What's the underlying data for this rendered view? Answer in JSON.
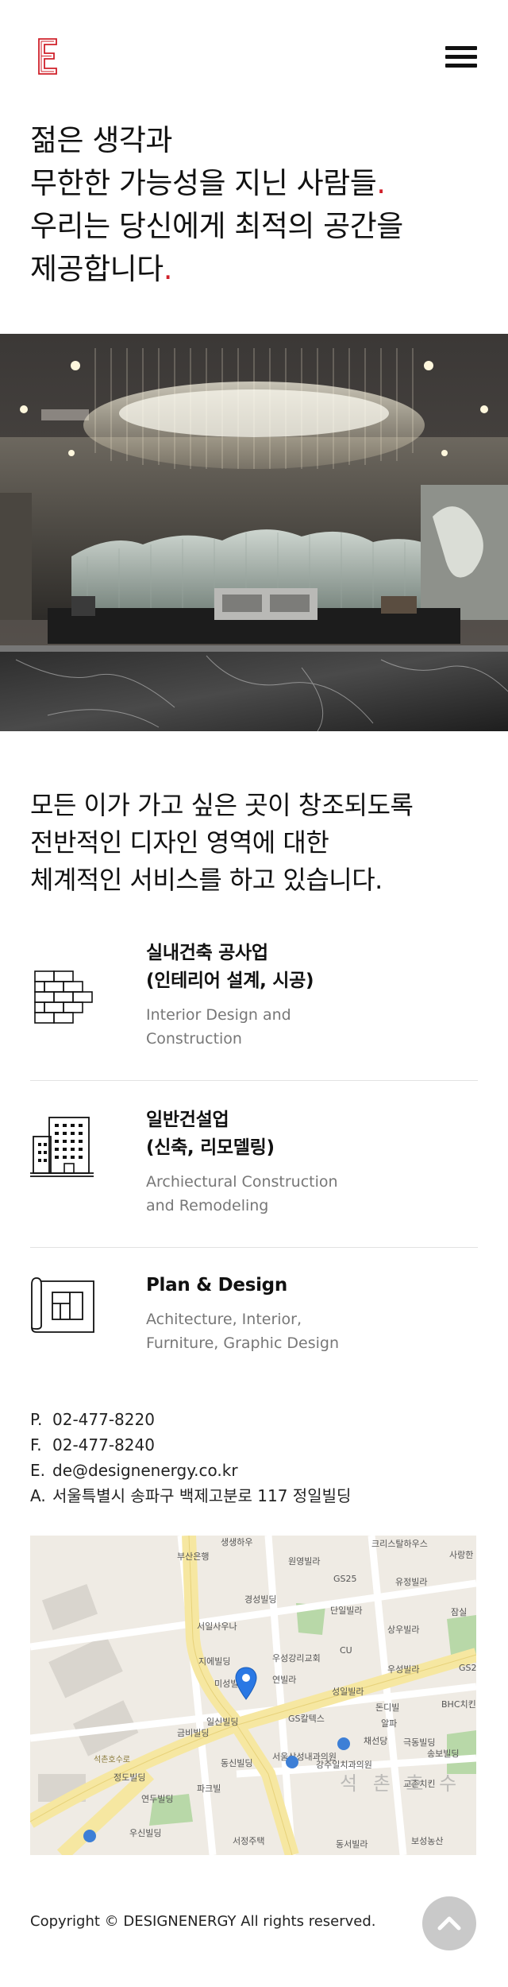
{
  "header": {
    "logo_icon": "letter-e-logo-icon",
    "menu_icon": "hamburger-menu-icon",
    "accent_color": "#d0202a"
  },
  "hero": {
    "line1": "젊은 생각과",
    "line2": "무한한 가능성을 지닌 사람들",
    "line3": "우리는 당신에게 최적의 공간을",
    "line4": "제공합니다",
    "period": "."
  },
  "intro": {
    "line1": "모든 이가 가고 싶은 곳이 창조되도록",
    "line2": "전반적인 디자인 영역에 대한",
    "line3": "체계적인 서비스를 하고 있습니다."
  },
  "services": [
    {
      "icon": "brick-wall-icon",
      "title_line1": "실내건축 공사업",
      "title_line2": "(인테리어 설계, 시공)",
      "desc_line1": "Interior Design and",
      "desc_line2": "Construction"
    },
    {
      "icon": "building-icon",
      "title_line1": "일반건설업",
      "title_line2": "(신축, 리모델링)",
      "desc_line1": "Archiectural Construction",
      "desc_line2": "and Remodeling"
    },
    {
      "icon": "blueprint-icon",
      "title_line1": "Plan & Design",
      "desc_line1": "Achitecture, Interior,",
      "desc_line2": "Furniture, Graphic Design"
    }
  ],
  "contact": {
    "phone_key": "P.",
    "phone": "02-477-8220",
    "fax_key": "F.",
    "fax": "02-477-8240",
    "email_key": "E.",
    "email": "de@designenergy.co.kr",
    "address_key": "A.",
    "address": "서울특별시 송파구 백제고분로 117 정일빌딩"
  },
  "map": {
    "pin_icon": "map-pin-icon",
    "labels": [
      "생생하우",
      "크리스탈하우스",
      "사랑한",
      "부산은행",
      "원영빌라",
      "GS25",
      "유정빌라",
      "경성빌딩",
      "단일빌라",
      "잠실",
      "서일사우나",
      "상우빌라",
      "지에빌딩",
      "우성강리교회",
      "CU",
      "우성빌라",
      "연빌라",
      "GS2",
      "미성빌",
      "성일빌라",
      "돈디빌",
      "BHC치킨",
      "일신빌딩",
      "GS칼텍스",
      "알파",
      "금비빌딩",
      "채선당",
      "극동빌딩",
      "송보빌딩",
      "동신빌딩",
      "서울삼성내과의원",
      "강주일치과의원",
      "정도빌딩",
      "파크빌",
      "교촌치킨",
      "연두빌딩",
      "우신빌딩",
      "서정주택",
      "동서빌라",
      "보성농산",
      "석촌호수로",
      "석 촌 호 수"
    ]
  },
  "footer": {
    "copyright": "Copyright © DESIGNENERGY All rights reserved.",
    "top_icon": "chevron-up-icon"
  }
}
